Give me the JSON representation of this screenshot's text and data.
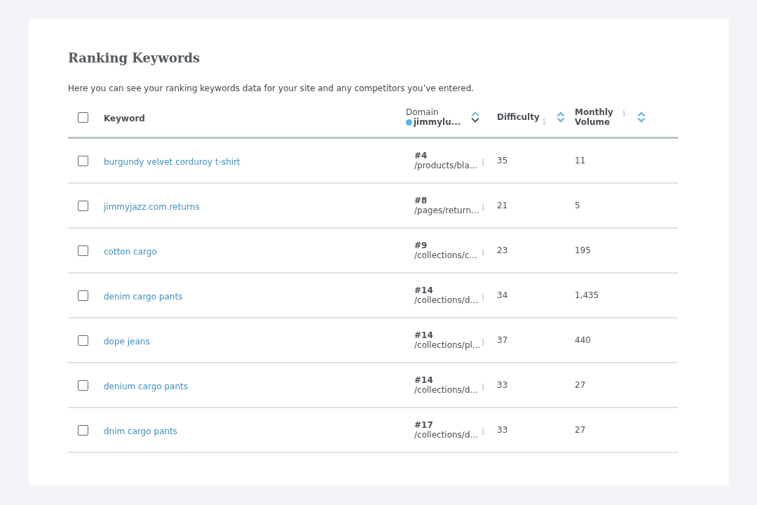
{
  "title": "Ranking Keywords",
  "description": "Here you can see your ranking keywords data for your site and any competitors you’ve entered.",
  "table": {
    "select_all": {
      "checked": false
    },
    "columns": [
      {
        "kind": "keyword",
        "label": "Keyword"
      },
      {
        "kind": "domain",
        "label": "Domain",
        "domain": "jimmylu...",
        "color": "#4db6e8",
        "sorted": true
      },
      {
        "kind": "difficulty",
        "label": "Difficulty",
        "info": true,
        "sorted": false
      },
      {
        "kind": "volume",
        "label": "Monthly Volume",
        "info": true,
        "sorted": false
      }
    ],
    "rows": [
      {
        "checked": false,
        "keyword": "burgundy velvet corduroy t-shirt",
        "rank": "#4",
        "url": "/products/bla...",
        "difficulty": "35",
        "volume": "11"
      },
      {
        "checked": false,
        "keyword": "jimmyjazz.com.returns",
        "rank": "#8",
        "url": "/pages/return...",
        "difficulty": "21",
        "volume": "5"
      },
      {
        "checked": false,
        "keyword": "cotton cargo",
        "rank": "#9",
        "url": "/collections/c...",
        "difficulty": "23",
        "volume": "195"
      },
      {
        "checked": false,
        "keyword": "denim cargo pants",
        "rank": "#14",
        "url": "/collections/d...",
        "difficulty": "34",
        "volume": "1,435"
      },
      {
        "checked": false,
        "keyword": "dope jeans",
        "rank": "#14",
        "url": "/collections/pl...",
        "difficulty": "37",
        "volume": "440"
      },
      {
        "checked": false,
        "keyword": "denium cargo pants",
        "rank": "#14",
        "url": "/collections/d...",
        "difficulty": "33",
        "volume": "27"
      },
      {
        "checked": false,
        "keyword": "dnim cargo pants",
        "rank": "#17",
        "url": "/collections/d...",
        "difficulty": "33",
        "volume": "27"
      }
    ]
  }
}
